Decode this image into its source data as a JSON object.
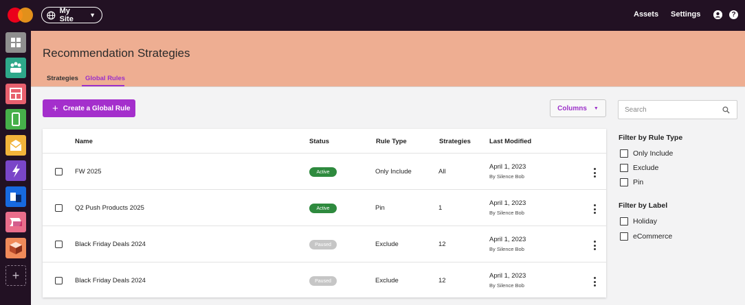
{
  "topbar": {
    "site_label": "My Site",
    "assets": "Assets",
    "settings": "Settings"
  },
  "sidebar": {
    "items": [
      {
        "name": "dashboard",
        "color": "#8f8f8f"
      },
      {
        "name": "audience",
        "color": "#2ea88a"
      },
      {
        "name": "web-layout",
        "color": "#e8606e"
      },
      {
        "name": "mobile",
        "color": "#46b04a"
      },
      {
        "name": "email",
        "color": "#f2b33a"
      },
      {
        "name": "campaigns",
        "color": "#7a46c9"
      },
      {
        "name": "integrations",
        "color": "#1769e0"
      },
      {
        "name": "content",
        "color": "#ea6d8b"
      },
      {
        "name": "products",
        "color": "#f08a5a"
      }
    ]
  },
  "header": {
    "title": "Recommendation Strategies",
    "tabs": [
      {
        "label": "Strategies",
        "active": false
      },
      {
        "label": "Global Rules",
        "active": true
      }
    ],
    "bg_color": "#eeae92"
  },
  "toolbar": {
    "create_label": "Create a Global Rule",
    "columns_label": "Columns"
  },
  "table": {
    "headers": {
      "name": "Name",
      "status": "Status",
      "rule_type": "Rule Type",
      "strategies": "Strategies",
      "last_modified": "Last Modified"
    },
    "rows": [
      {
        "name": "FW 2025",
        "status": "Active",
        "rule_type": "Only Include",
        "strategies": "All",
        "date": "April 1, 2023",
        "by": "By Silence Bob"
      },
      {
        "name": "Q2 Push Products 2025",
        "status": "Active",
        "rule_type": "Pin",
        "strategies": "1",
        "date": "April 1, 2023",
        "by": "By Silence Bob"
      },
      {
        "name": "Black Friday Deals 2024",
        "status": "Paused",
        "rule_type": "Exclude",
        "strategies": "12",
        "date": "April 1, 2023",
        "by": "By Silence Bob"
      },
      {
        "name": "Black Friday Deals 2024",
        "status": "Paused",
        "rule_type": "Exclude",
        "strategies": "12",
        "date": "April 1, 2023",
        "by": "By Silence Bob"
      }
    ]
  },
  "filters": {
    "search_placeholder": "Search",
    "rule_type_title": "Filter by Rule Type",
    "rule_types": [
      "Only Include",
      "Exclude",
      "Pin"
    ],
    "label_title": "Filter by Label",
    "labels": [
      "Holiday",
      "eCommerce"
    ]
  },
  "colors": {
    "accent": "#a42fcc",
    "active_badge": "#2e8a3e",
    "paused_badge": "#c6c6c6",
    "topbar": "#221123"
  }
}
